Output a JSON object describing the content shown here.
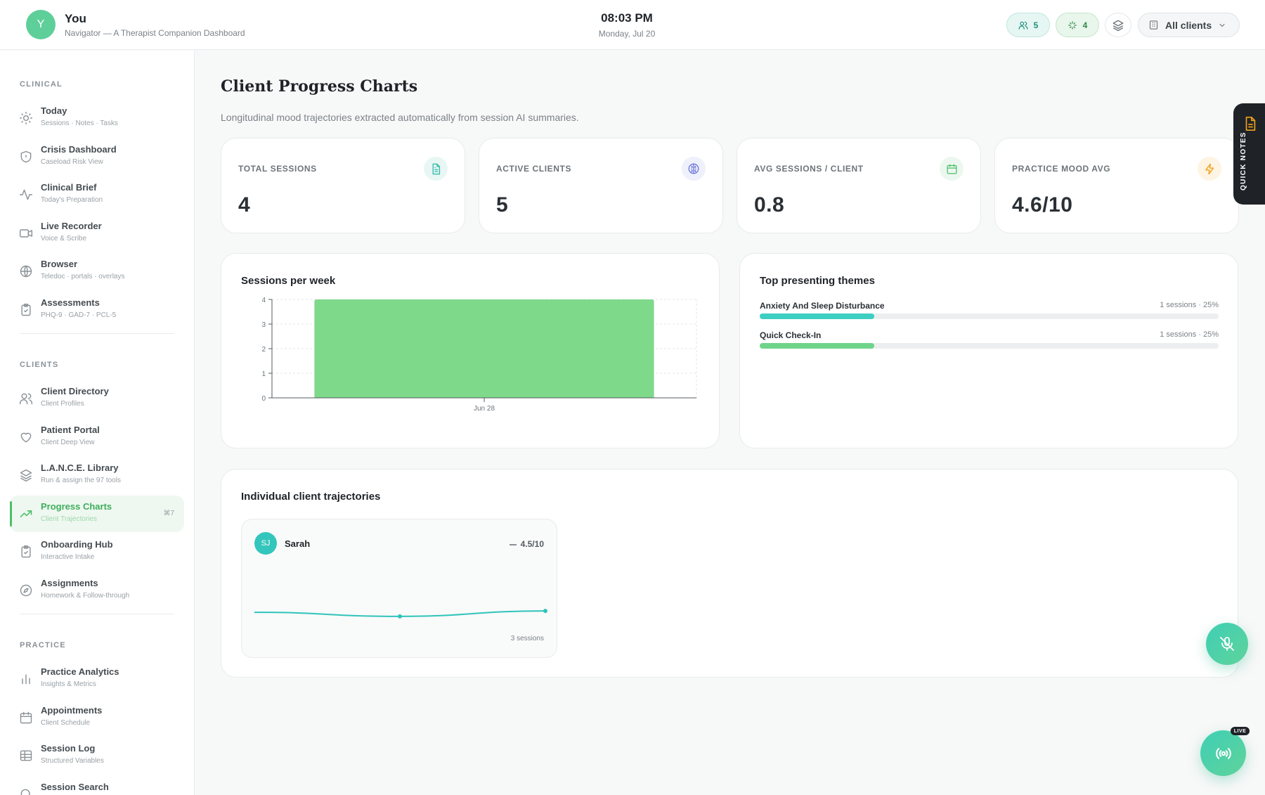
{
  "header": {
    "avatar_initial": "Y",
    "user_name": "You",
    "subtitle": "Navigator — A Therapist Companion Dashboard",
    "time": "08:03 PM",
    "date": "Monday, Jul 20",
    "clients_count": "5",
    "activity_count": "4",
    "client_filter": "All clients"
  },
  "sidebar": {
    "sections": [
      {
        "label": "CLINICAL",
        "items": [
          {
            "title": "Today",
            "sub": "Sessions · Notes · Tasks",
            "icon": "sun-icon"
          },
          {
            "title": "Crisis Dashboard",
            "sub": "Caseload Risk View",
            "icon": "shield-icon"
          },
          {
            "title": "Clinical Brief",
            "sub": "Today's Preparation",
            "icon": "activity-icon"
          },
          {
            "title": "Live Recorder",
            "sub": "Voice & Scribe",
            "icon": "video-icon"
          },
          {
            "title": "Browser",
            "sub": "Teledoc · portals · overlays",
            "icon": "globe-icon"
          },
          {
            "title": "Assessments",
            "sub": "PHQ-9 · GAD-7 · PCL-5",
            "icon": "clipboard-check-icon"
          }
        ]
      },
      {
        "label": "CLIENTS",
        "items": [
          {
            "title": "Client Directory",
            "sub": "Client Profiles",
            "icon": "users-icon"
          },
          {
            "title": "Patient Portal",
            "sub": "Client Deep View",
            "icon": "heart-icon"
          },
          {
            "title": "L.A.N.C.E. Library",
            "sub": "Run & assign the 97 tools",
            "icon": "layers-icon"
          },
          {
            "title": "Progress Charts",
            "sub": "Client Trajectories",
            "icon": "trending-up-icon",
            "kbd": "⌘7",
            "active": true
          },
          {
            "title": "Onboarding Hub",
            "sub": "Interactive Intake",
            "icon": "clipboard-icon"
          },
          {
            "title": "Assignments",
            "sub": "Homework & Follow-through",
            "icon": "compass-icon"
          }
        ]
      },
      {
        "label": "PRACTICE",
        "items": [
          {
            "title": "Practice Analytics",
            "sub": "Insights & Metrics",
            "icon": "bar-chart-icon"
          },
          {
            "title": "Appointments",
            "sub": "Client Schedule",
            "icon": "calendar-icon"
          },
          {
            "title": "Session Log",
            "sub": "Structured Variables",
            "icon": "table-icon"
          },
          {
            "title": "Session Search",
            "sub": "",
            "icon": "search-icon"
          }
        ]
      }
    ]
  },
  "main": {
    "title": "Client Progress Charts",
    "subtitle": "Longitudinal mood trajectories extracted automatically from session AI summaries.",
    "kpis": [
      {
        "label": "TOTAL SESSIONS",
        "value": "4",
        "icon": "file-text-icon",
        "color": "#2bb8a6",
        "bg": "#e8f7f4"
      },
      {
        "label": "ACTIVE CLIENTS",
        "value": "5",
        "icon": "brain-icon",
        "color": "#6a72d9",
        "bg": "#eef0fb"
      },
      {
        "label": "AVG SESSIONS / CLIENT",
        "value": "0.8",
        "icon": "calendar-icon",
        "color": "#4cbf6a",
        "bg": "#ecf8ef"
      },
      {
        "label": "PRACTICE MOOD AVG",
        "value": "4.6/10",
        "icon": "zap-icon",
        "color": "#f0a21a",
        "bg": "#fdf4e3"
      }
    ],
    "sessions_chart_title": "Sessions per week",
    "themes_title": "Top presenting themes",
    "themes": [
      {
        "name": "Anxiety And Sleep Disturbance",
        "meta": "1 sessions · 25%",
        "pct": 25,
        "color": "#3ccfc2"
      },
      {
        "name": "Quick Check-In",
        "meta": "1 sessions · 25%",
        "pct": 25,
        "color": "#6fd48a"
      }
    ],
    "trajectories_title": "Individual client trajectories",
    "trajectory": {
      "initials": "SJ",
      "name": "Sarah",
      "score": "4.5/10",
      "sessions": "3 sessions",
      "mood_values": [
        5.2,
        4.6,
        5.4
      ],
      "color": "#2fc4ba"
    }
  },
  "chart_data": {
    "type": "bar",
    "categories": [
      "Jun 28"
    ],
    "values": [
      4
    ],
    "title": "Sessions per week",
    "xlabel": "",
    "ylabel": "",
    "ylim": [
      0,
      4
    ],
    "yticks": [
      0,
      1,
      2,
      3,
      4
    ],
    "grid": true,
    "color": "#7fd98a"
  },
  "quick_notes_label": "QUICK NOTES",
  "live_badge": "LIVE"
}
